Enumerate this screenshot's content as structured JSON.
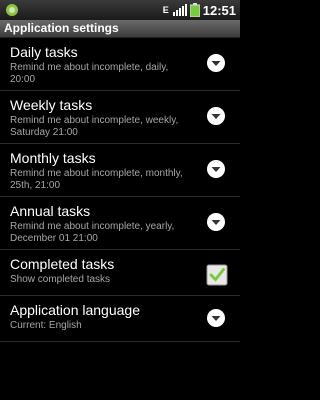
{
  "status": {
    "time": "12:51",
    "carrier_letter": "E",
    "icons": [
      "android-icon",
      "signal-icon",
      "battery-icon"
    ]
  },
  "title": "Application settings",
  "items": [
    {
      "title": "Daily tasks",
      "summary": "Remind me about incomplete, daily, 20:00",
      "control": "dropdown"
    },
    {
      "title": "Weekly tasks",
      "summary": "Remind me about incomplete, weekly, Saturday 21:00",
      "control": "dropdown"
    },
    {
      "title": "Monthly tasks",
      "summary": "Remind me about incomplete, monthly, 25th, 21:00",
      "control": "dropdown"
    },
    {
      "title": "Annual tasks",
      "summary": "Remind me about incomplete, yearly, December 01 21:00",
      "control": "dropdown"
    },
    {
      "title": "Completed tasks",
      "summary": "Show completed tasks",
      "control": "checkbox",
      "checked": true
    },
    {
      "title": "Application language",
      "summary": "Current: English",
      "control": "dropdown"
    }
  ],
  "colors": {
    "accent_check": "#7ac943",
    "summary_text": "#a6a6a6"
  }
}
